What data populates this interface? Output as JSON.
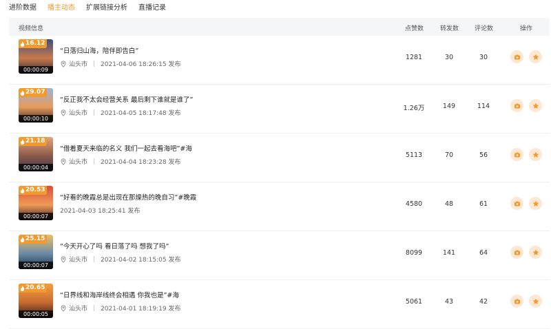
{
  "tabs": [
    {
      "label": "进阶数据",
      "active": false
    },
    {
      "label": "播主动态",
      "active": true
    },
    {
      "label": "扩展链接分析",
      "active": false
    },
    {
      "label": "直播记录",
      "active": false
    }
  ],
  "table": {
    "headers": {
      "info": "视频信息",
      "likes": "点赞数",
      "shares": "转发数",
      "comments": "评论数",
      "actions": "操作"
    },
    "rows": [
      {
        "heat": "16.12",
        "duration": "00:00:09",
        "title": "“日落归山海，陪伴即告白”",
        "location": "汕头市",
        "time": "2021-04-06 18:26:15 发布",
        "likes": "1281",
        "shares": "30",
        "comments": "30",
        "sky": [
          "#3b4e82",
          "#c97a4a",
          "#2a2a3a"
        ]
      },
      {
        "heat": "29.07",
        "duration": "00:00:10",
        "title": "“反正我不太会经营关系 最后剩下谁就是谁了”",
        "location": "汕头市",
        "time": "2021-04-05 18:17:48 发布",
        "likes": "1.26万",
        "shares": "149",
        "comments": "114",
        "sky": [
          "#9db4d8",
          "#e79a5a",
          "#3a2c2c"
        ]
      },
      {
        "heat": "21.18",
        "duration": "00:00:04",
        "title": "“借着夏天来临的名义 我们一起去看海吧”#海",
        "location": "汕头市",
        "time": "2021-04-04 18:23:28 发布",
        "likes": "5113",
        "shares": "70",
        "comments": "56",
        "sky": [
          "#e6a47a",
          "#8a5a4a",
          "#3a3448"
        ]
      },
      {
        "heat": "20.53",
        "duration": "00:00:07",
        "title": "“好看的晚霞总是出现在那燥热的晚自习”#晚霞",
        "location": "",
        "time": "2021-04-03 18:25:41 发布",
        "likes": "4580",
        "shares": "48",
        "comments": "61",
        "sky": [
          "#d94e3a",
          "#f09a56",
          "#3a2020"
        ]
      },
      {
        "heat": "25.15",
        "duration": "00:00:07",
        "title": "“今天开心了吗 看日落了吗 想我了吗”",
        "location": "汕头市",
        "time": "2021-04-02 18:15:05 发布",
        "likes": "8099",
        "shares": "141",
        "comments": "64",
        "sky": [
          "#f0c060",
          "#6a8aa8",
          "#203040"
        ]
      },
      {
        "heat": "20.65",
        "duration": "00:00:05",
        "title": "“日界线和海岸线终会相遇 你我也是”#海",
        "location": "汕头市",
        "time": "2021-04-01 18:19:19 发布",
        "likes": "5061",
        "shares": "43",
        "comments": "42",
        "sky": [
          "#f6a040",
          "#c86a30",
          "#2a1a18"
        ]
      }
    ]
  },
  "colors": {
    "accent": "#f39a2f",
    "button_bg": "#fde8d4"
  },
  "icons": {
    "heat": "flame-icon",
    "location": "location-pin-icon",
    "action1": "video-camera-icon",
    "action2": "star-icon"
  }
}
